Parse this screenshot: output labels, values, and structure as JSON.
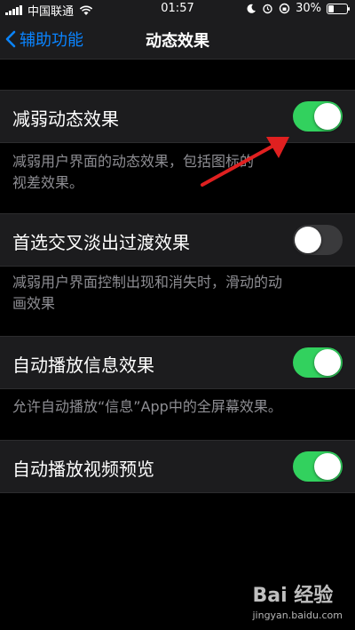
{
  "status_bar": {
    "carrier": "中国联通",
    "time": "01:57",
    "battery_percent": "30%",
    "battery_level": 0.3,
    "icons": [
      "signal-icon",
      "wifi-icon",
      "moon-icon",
      "alarm-icon",
      "rotation-lock-icon",
      "battery-icon"
    ]
  },
  "nav": {
    "back_label": "辅助功能",
    "title": "动态效果"
  },
  "settings": [
    {
      "label": "减弱动态效果",
      "on": true,
      "desc_lines": [
        "减弱用户界面的动态效果，包括图标的",
        "视差效果。"
      ]
    },
    {
      "label": "首选交叉淡出过渡效果",
      "on": false,
      "desc_lines": [
        "减弱用户界面控制出现和消失时，滑动的动",
        "画效果"
      ]
    },
    {
      "label": "自动播放信息效果",
      "on": true,
      "desc_lines": [
        "允许自动播放“信息”App中的全屏幕效果。"
      ]
    },
    {
      "label": "自动播放视频预览",
      "on": true,
      "desc_lines": []
    }
  ],
  "colors": {
    "toggle_on": "#32d15e",
    "toggle_off": "#3a3a3c",
    "accent": "#0a84ff",
    "arrow": "#e02020"
  },
  "watermark": {
    "logo_text": "Bai 经验",
    "url": "jingyan.baidu.com"
  }
}
